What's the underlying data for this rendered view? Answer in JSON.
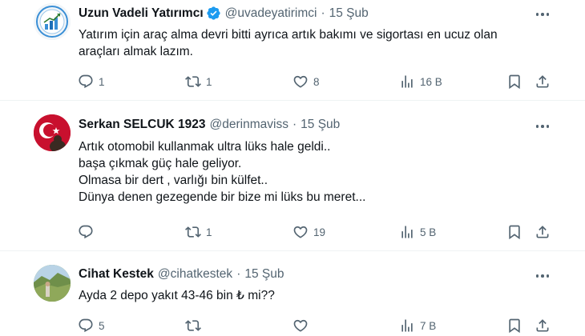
{
  "tweets": [
    {
      "name": "Uzun Vadeli Yatırımcı",
      "handle": "@uvadeyatirimci",
      "separator": "·",
      "date": "15 Şub",
      "verified": true,
      "text": [
        "Yatırım için araç alma devri bitti ayrıca artık bakımı ve sigortası en ucuz olan",
        "araçları almak lazım."
      ],
      "reply_count": "1",
      "retweet_count": "1",
      "like_count": "8",
      "view_count": "16 B"
    },
    {
      "name": "Serkan SELCUK 1923",
      "handle": "@derinmaviss",
      "separator": "·",
      "date": "15 Şub",
      "verified": false,
      "text": [
        "Artık otomobil kullanmak ultra lüks hale geldi..",
        "başa çıkmak güç hale geliyor.",
        "Olmasa bir dert , varlığı bin külfet..",
        "Dünya denen gezegende bir bize mi lüks bu meret..."
      ],
      "reply_count": "",
      "retweet_count": "1",
      "like_count": "19",
      "view_count": "5 B"
    },
    {
      "name": "Cihat Kestek",
      "handle": "@cihatkestek",
      "separator": "·",
      "date": "15 Şub",
      "verified": false,
      "text": [
        "Ayda 2 depo yakıt 43-46 bin ₺ mi??"
      ],
      "reply_count": "5",
      "retweet_count": "",
      "like_count": "",
      "view_count": "7 B"
    }
  ],
  "colors": {
    "text_primary": "#0f1419",
    "text_secondary": "#536471",
    "verified_blue": "#1d9bf0",
    "divider": "#eff3f4"
  },
  "icons": [
    "reply-icon",
    "retweet-icon",
    "like-icon",
    "views-icon",
    "bookmark-icon",
    "share-icon",
    "more-icon",
    "verified-badge-icon"
  ]
}
